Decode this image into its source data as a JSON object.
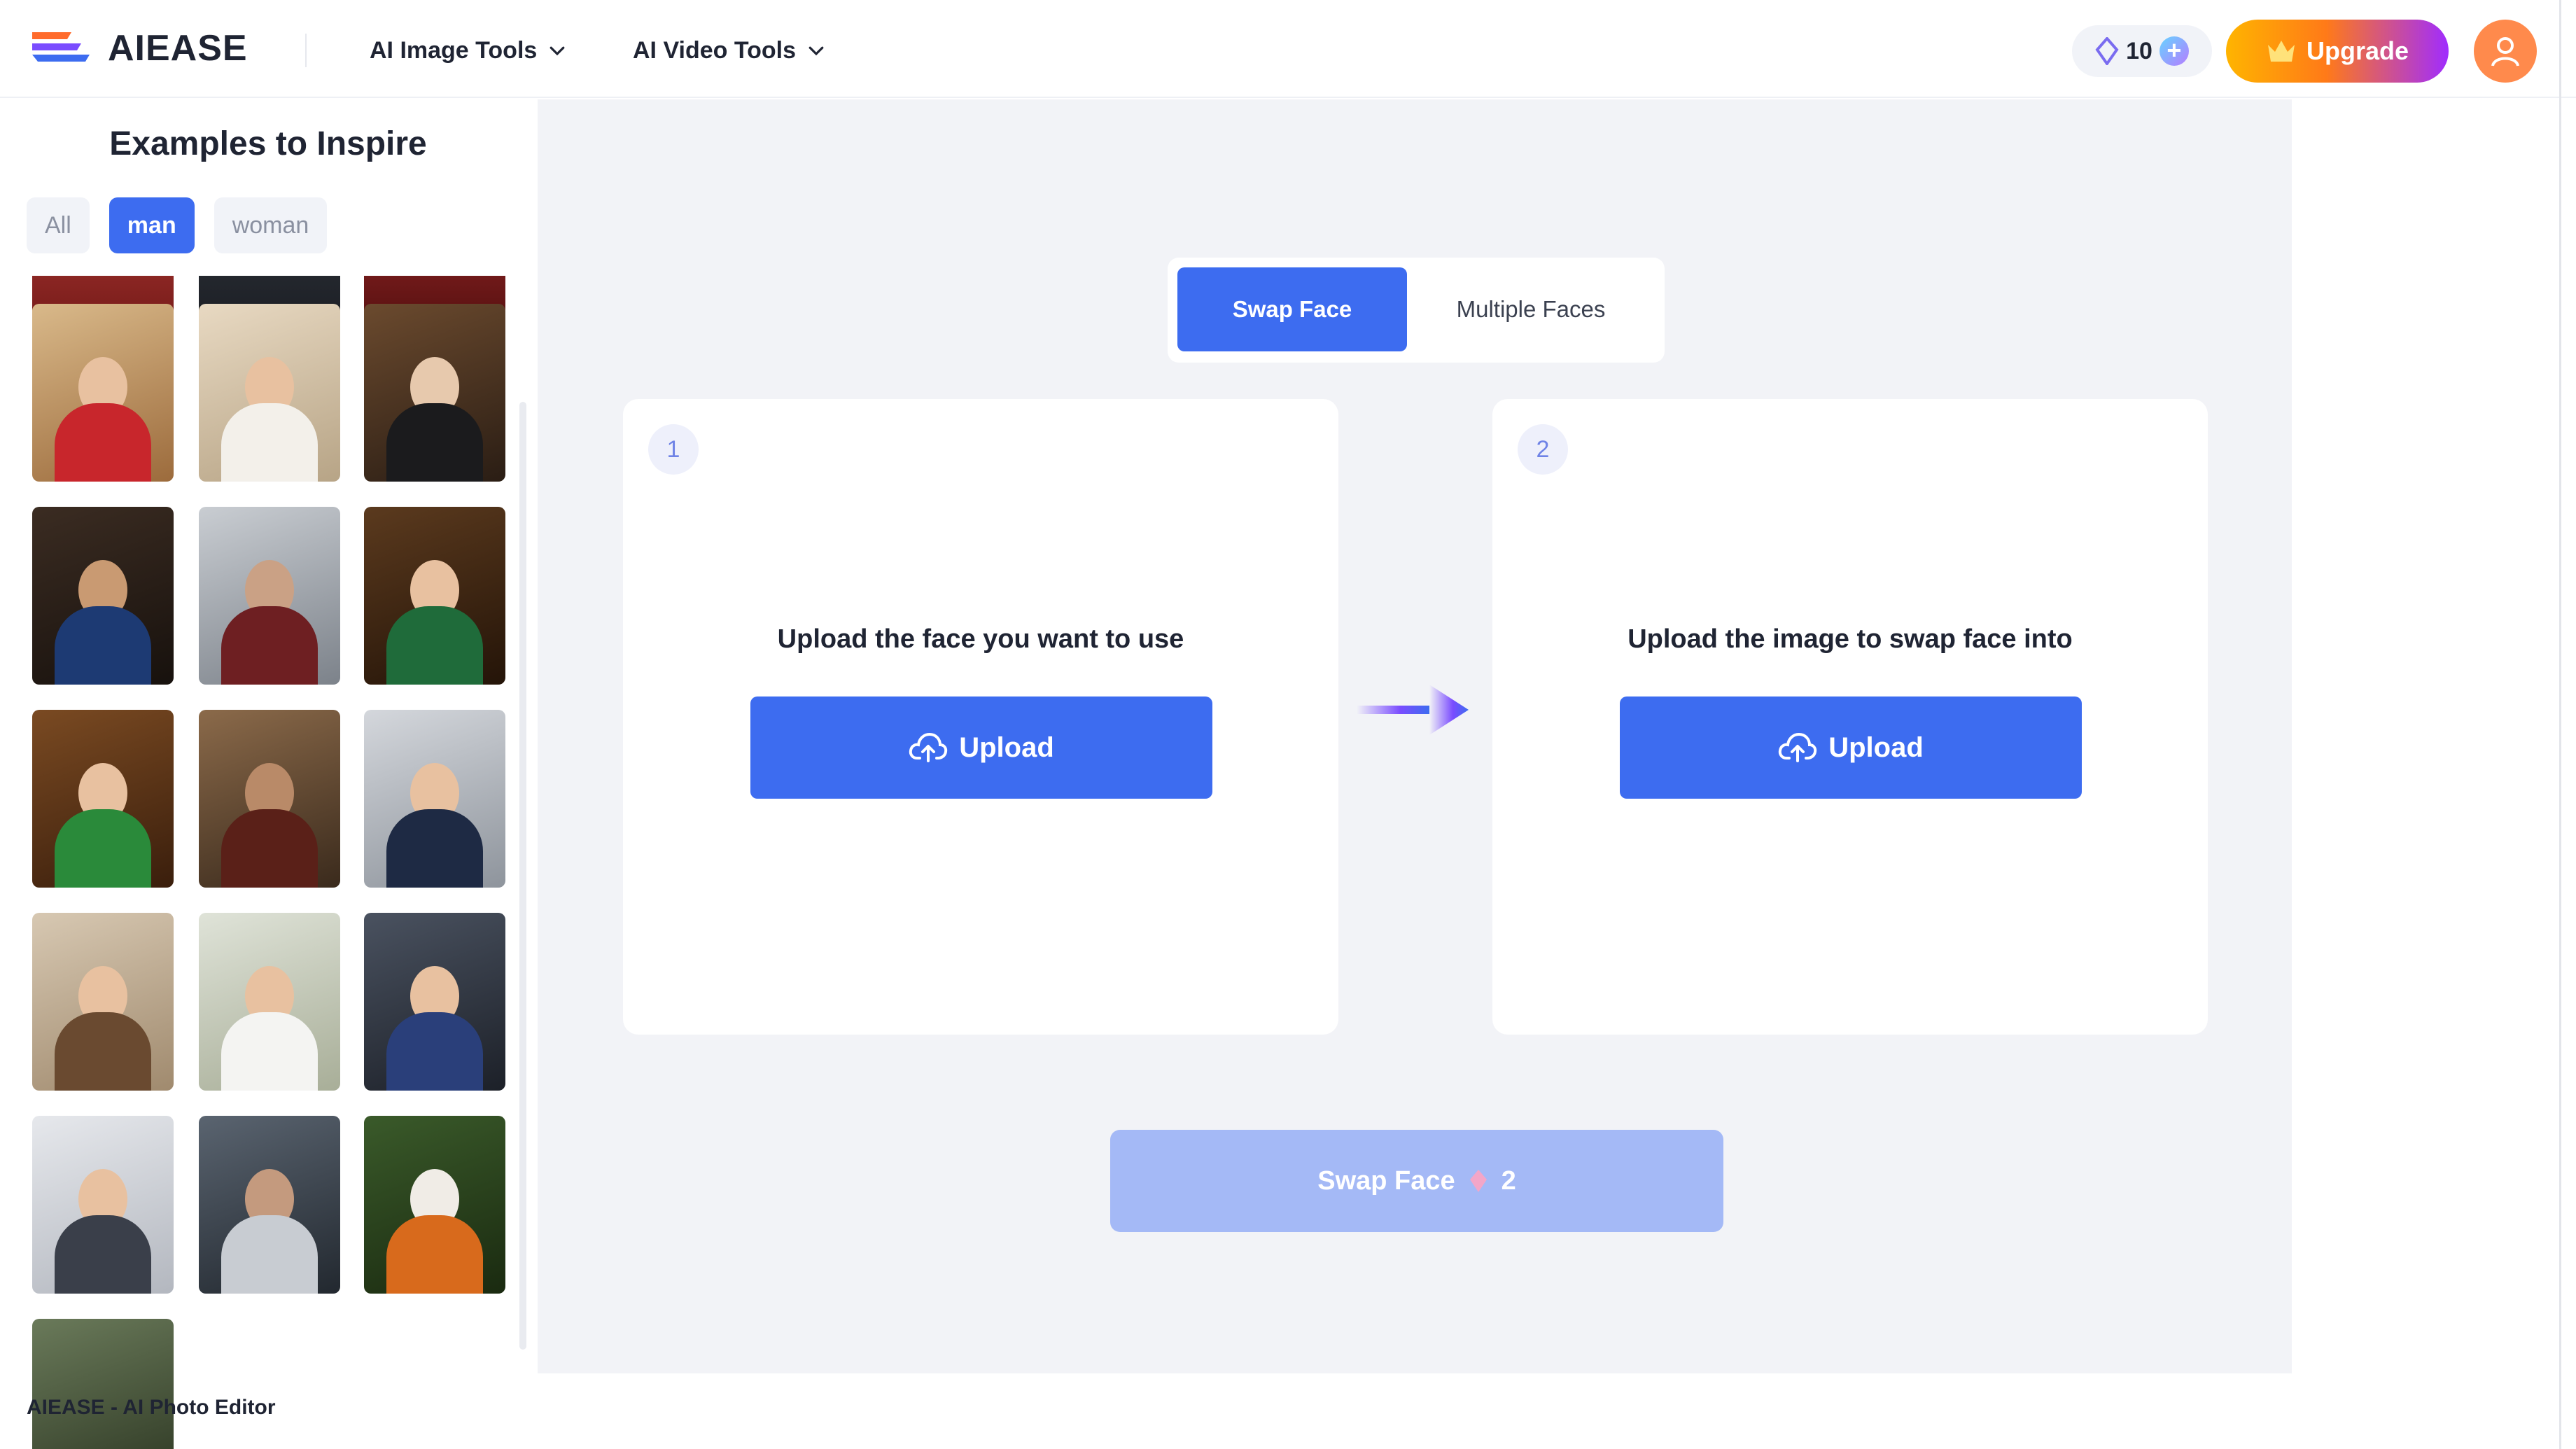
{
  "header": {
    "logo_text": "AIEASE",
    "nav": [
      {
        "label": "AI Image Tools",
        "icon": "chevron-down-icon"
      },
      {
        "label": "AI Video Tools",
        "icon": "chevron-down-icon"
      }
    ],
    "credits": "10",
    "upgrade_label": "Upgrade"
  },
  "sidebar": {
    "title": "Examples to Inspire",
    "filters": [
      {
        "label": "All",
        "active": false
      },
      {
        "label": "man",
        "active": true
      },
      {
        "label": "woman",
        "active": false
      }
    ],
    "promo_text": "AIEASE - AI Photo Editor"
  },
  "main": {
    "tabs": [
      {
        "label": "Swap Face",
        "active": true
      },
      {
        "label": "Multiple Faces",
        "active": false
      }
    ],
    "cards": [
      {
        "step": "1",
        "prompt": "Upload the face you want to use",
        "button": "Upload"
      },
      {
        "step": "2",
        "prompt": "Upload the image to swap face into",
        "button": "Upload"
      }
    ],
    "swap_button": {
      "label": "Swap Face",
      "cost": "2"
    }
  },
  "colors": {
    "accent": "#3d6cf0",
    "accent_disabled": "#a4b9f6",
    "background": "#f2f3f7",
    "upgrade_gradient": [
      "#ffb400",
      "#ff7a18",
      "#a02cff"
    ]
  }
}
